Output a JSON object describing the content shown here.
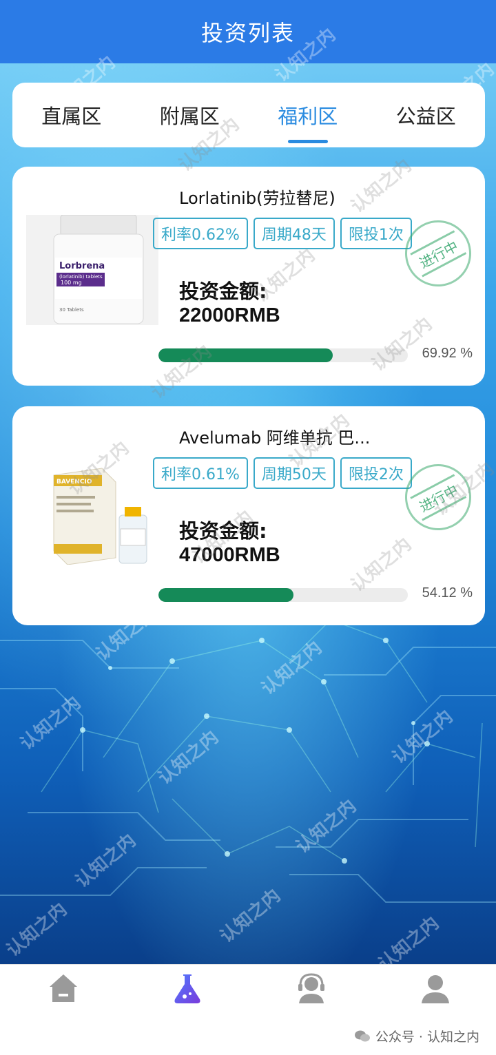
{
  "header": {
    "title": "投资列表"
  },
  "tabs": [
    {
      "label": "直属区",
      "active": false
    },
    {
      "label": "附属区",
      "active": false
    },
    {
      "label": "福利区",
      "active": true
    },
    {
      "label": "公益区",
      "active": false
    }
  ],
  "products": [
    {
      "name": "Lorlatinib(劳拉替尼)",
      "rate": "利率0.62%",
      "period": "周期48天",
      "limit": "限投1次",
      "status": "进行中",
      "amount_label": "投资金额:",
      "amount_value": "22000RMB",
      "progress": 0.6992,
      "progress_text": "69.92 %",
      "image_icon": "lorbrena-bottle-image",
      "image_text": {
        "brand": "Lorbrena",
        "sub": "(lorlatinib) tablets",
        "dose": "100 mg",
        "count": "30 Tablets"
      }
    },
    {
      "name": "Avelumab 阿维单抗 巴...",
      "rate": "利率0.61%",
      "period": "周期50天",
      "limit": "限投2次",
      "status": "进行中",
      "amount_label": "投资金额:",
      "amount_value": "47000RMB",
      "progress": 0.5412,
      "progress_text": "54.12 %",
      "image_icon": "bavencio-box-vial-image",
      "image_text": {
        "brand": "BAVENCIO"
      }
    }
  ],
  "tabbar": {
    "items": [
      {
        "icon": "home-icon"
      },
      {
        "icon": "flask-icon"
      },
      {
        "icon": "headset-icon"
      },
      {
        "icon": "user-icon"
      }
    ]
  },
  "watermark": "认知之内",
  "footer": {
    "note": "公众号 · 认知之内"
  },
  "colors": {
    "header": "#2b7be6",
    "accent": "#2a8be0",
    "chip": "#39a9c9",
    "progress": "#158a58"
  }
}
